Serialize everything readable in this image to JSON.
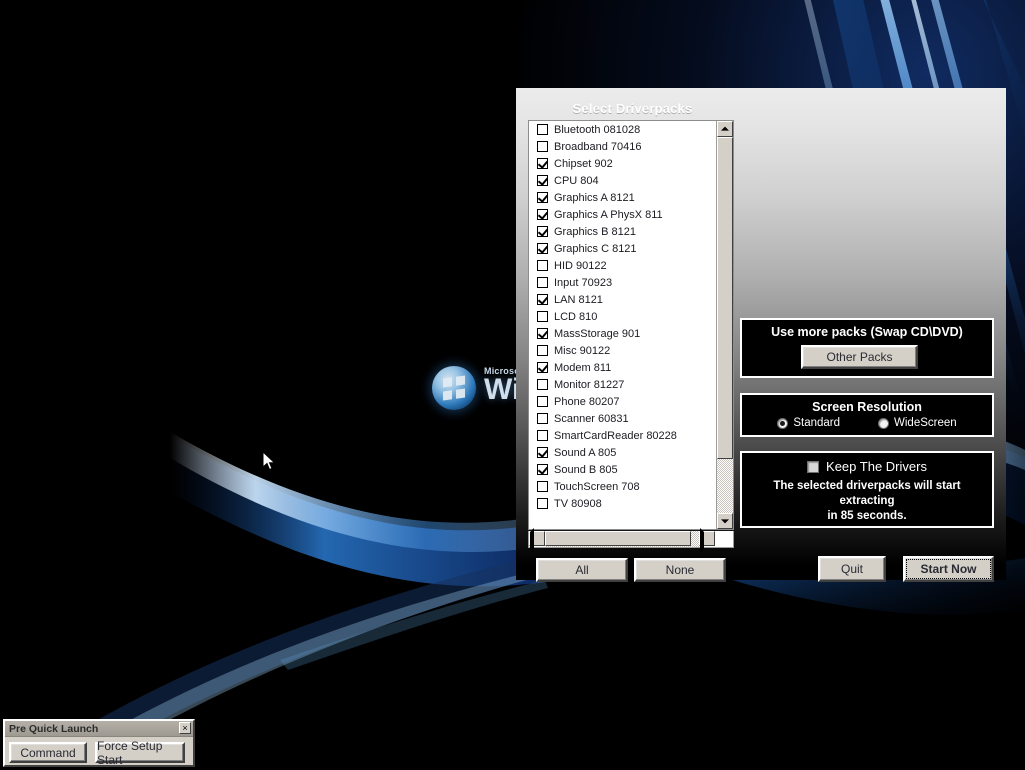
{
  "desktop": {
    "watermark": {
      "brand": "Microsoft",
      "product": "Win"
    }
  },
  "dialog": {
    "title": "Select Driverpacks",
    "driverpacks": [
      {
        "label": "Bluetooth 081028",
        "checked": false
      },
      {
        "label": "Broadband 70416",
        "checked": false
      },
      {
        "label": "Chipset 902",
        "checked": true
      },
      {
        "label": "CPU 804",
        "checked": true
      },
      {
        "label": "Graphics A 8121",
        "checked": true
      },
      {
        "label": "Graphics A PhysX 811",
        "checked": true
      },
      {
        "label": "Graphics B 8121",
        "checked": true
      },
      {
        "label": "Graphics C 8121",
        "checked": true
      },
      {
        "label": "HID 90122",
        "checked": false
      },
      {
        "label": "Input 70923",
        "checked": false
      },
      {
        "label": "LAN 8121",
        "checked": true
      },
      {
        "label": "LCD 810",
        "checked": false
      },
      {
        "label": "MassStorage 901",
        "checked": true
      },
      {
        "label": "Misc 90122",
        "checked": false
      },
      {
        "label": "Modem 811",
        "checked": true
      },
      {
        "label": "Monitor 81227",
        "checked": false
      },
      {
        "label": "Phone 80207",
        "checked": false
      },
      {
        "label": "Scanner 60831",
        "checked": false
      },
      {
        "label": "SmartCardReader 80228",
        "checked": false
      },
      {
        "label": "Sound A 805",
        "checked": true
      },
      {
        "label": "Sound B 805",
        "checked": true
      },
      {
        "label": "TouchScreen 708",
        "checked": false
      },
      {
        "label": "TV 80908",
        "checked": false
      }
    ],
    "list_buttons": {
      "all": "All",
      "none": "None"
    },
    "more_packs": {
      "title": "Use more packs (Swap CD\\DVD)",
      "button": "Other Packs"
    },
    "screen_resolution": {
      "title": "Screen Resolution",
      "options": [
        {
          "label": "Standard",
          "selected": true
        },
        {
          "label": "WideScreen",
          "selected": false
        }
      ]
    },
    "keep_drivers": {
      "label": "Keep The Drivers",
      "checked": false,
      "message_line1": "The selected driverpacks will start extracting",
      "message_line2": "in 85 seconds.",
      "countdown_seconds": "85"
    },
    "action_buttons": {
      "quit": "Quit",
      "start": "Start Now"
    }
  },
  "pre_quick_launch": {
    "title": "Pre Quick Launch",
    "close": "×",
    "buttons": {
      "command": "Command",
      "force_setup_start": "Force Setup Start"
    }
  },
  "colors": {
    "dialog_top": "#ececec",
    "dialog_bottom": "#000000",
    "button_face": "#d4d0c8",
    "group_border": "#ffffff",
    "group_fill": "#000000",
    "accent_blue": "#2f7fc4"
  }
}
